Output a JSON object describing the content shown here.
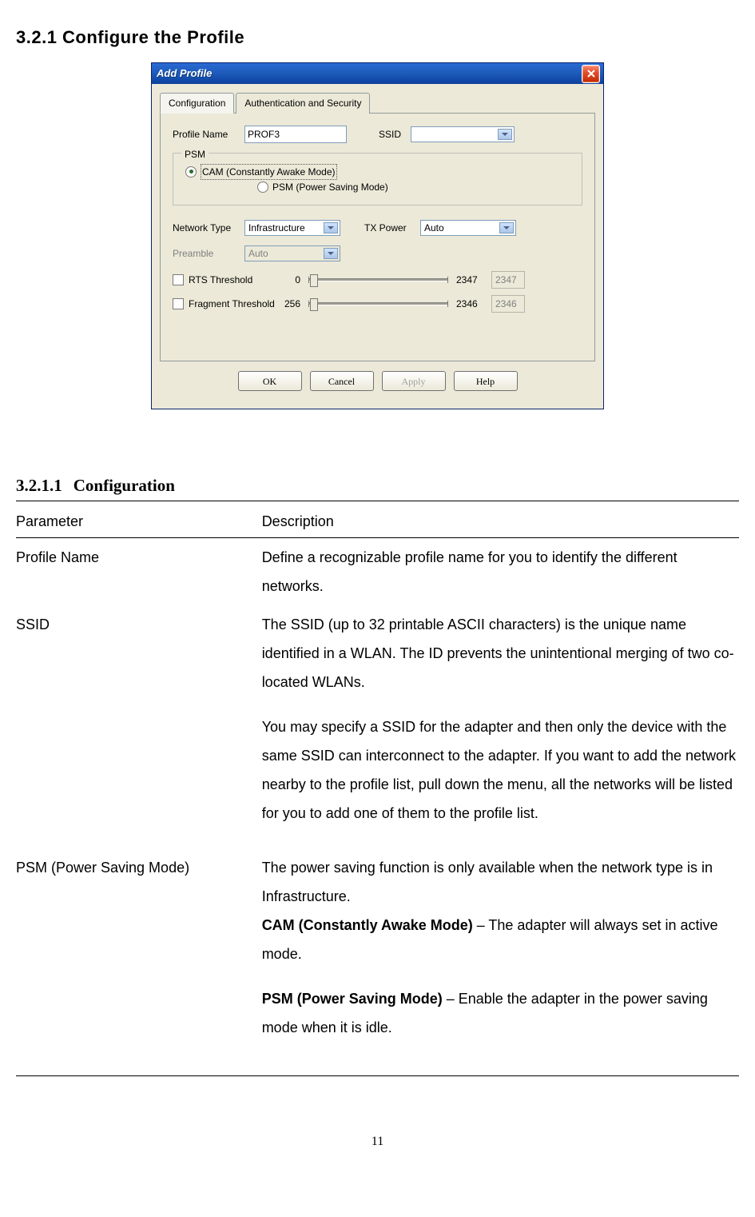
{
  "section_heading": "3.2.1  Configure the Profile",
  "dialog": {
    "title": "Add Profile",
    "tabs": [
      "Configuration",
      "Authentication and Security"
    ],
    "profile_name_label": "Profile Name",
    "profile_name_value": "PROF3",
    "ssid_label": "SSID",
    "ssid_value": "",
    "psm_legend": "PSM",
    "cam_radio_label": "CAM (Constantly Awake Mode)",
    "psm_radio_label": "PSM (Power Saving Mode)",
    "network_type_label": "Network Type",
    "network_type_value": "Infrastructure",
    "tx_power_label": "TX Power",
    "tx_power_value": "Auto",
    "preamble_label": "Preamble",
    "preamble_value": "Auto",
    "rts_label": "RTS Threshold",
    "rts_min": "0",
    "rts_max": "2347",
    "rts_value": "2347",
    "frag_label": "Fragment Threshold",
    "frag_min": "256",
    "frag_max": "2346",
    "frag_value": "2346",
    "ok": "OK",
    "cancel": "Cancel",
    "apply": "Apply",
    "help": "Help"
  },
  "subsection_num": "3.2.1.1",
  "subsection_title": "Configuration",
  "table_headers": {
    "param": "Parameter",
    "desc": "Description"
  },
  "rows": {
    "profile_name": {
      "param": "Profile Name",
      "desc": "Define a recognizable profile name for you to identify the different networks."
    },
    "ssid": {
      "param": "SSID",
      "p1": "The SSID (up to 32 printable ASCII characters) is the unique name identified in a WLAN. The ID prevents the unintentional merging of two co-located WLANs.",
      "p2": "You may specify a SSID for the adapter and then only the device with the same SSID can interconnect to the adapter. If you want to add the network nearby to the profile list, pull down the menu, all the networks will be listed for you to add one of them to the profile list."
    },
    "psm": {
      "param": "PSM (Power Saving Mode)",
      "intro": "The power saving function is only available when the network type is in Infrastructure.",
      "cam_bold": "CAM (Constantly Awake Mode)",
      "cam_rest": " – The adapter will always set in active mode.",
      "psm_bold": "PSM (Power Saving Mode)",
      "psm_rest": " – Enable the adapter in the power saving mode when it is idle."
    }
  },
  "page_number": "11"
}
